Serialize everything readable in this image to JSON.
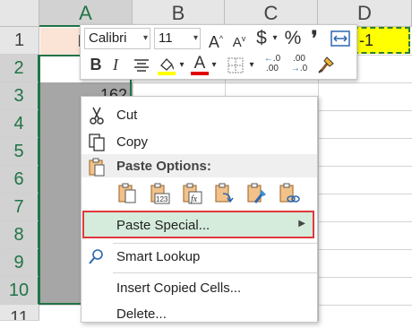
{
  "sheet": {
    "columns": [
      "A",
      "B",
      "C",
      "D"
    ],
    "rows": [
      "1",
      "2",
      "3",
      "4",
      "5",
      "6",
      "7",
      "8",
      "9",
      "10",
      "11"
    ],
    "cells": {
      "a1": "Da",
      "d1": "-1",
      "a3": "162"
    }
  },
  "mini_toolbar": {
    "font_name": "Calibri",
    "font_size": "11",
    "grow_font": "A",
    "shrink_font": "A",
    "currency": "$",
    "percent": "%",
    "comma": "❜",
    "bold": "B",
    "italic": "I",
    "font_color": "A",
    "increase_decimal": ".0",
    "decrease_decimal": ".00",
    "colors": {
      "fill_yellow": "#ffff00",
      "font_red": "#e00000"
    }
  },
  "context_menu": {
    "cut": "Cut",
    "copy": "Copy",
    "paste_options": "Paste Options:",
    "paste_special": "Paste Special...",
    "smart_lookup": "Smart Lookup",
    "insert_copied_cells": "Insert Copied Cells...",
    "delete": "Delete..."
  },
  "colors": {
    "excel_green": "#217346",
    "highlight_bg": "#d5ecdc",
    "highlight_border": "#e0383c",
    "selection_fill": "#a6a6a6",
    "header_bg": "#fbe3d6",
    "d1_fill": "#ffff00"
  }
}
